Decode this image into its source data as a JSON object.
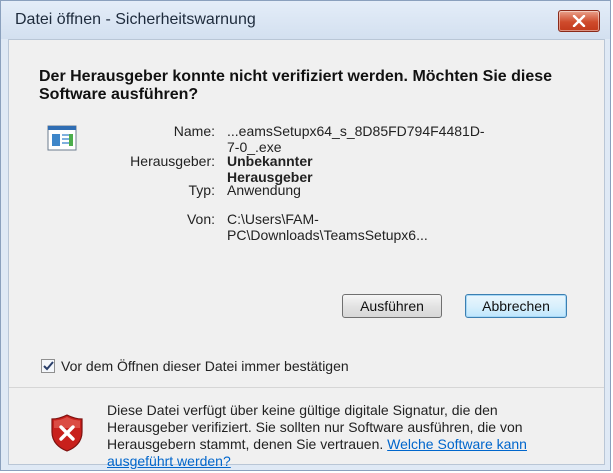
{
  "window": {
    "title": "Datei öffnen - Sicherheitswarnung"
  },
  "heading": "Der Herausgeber konnte nicht verifiziert werden. Möchten Sie diese Software ausführen?",
  "details": {
    "name_label": "Name:",
    "name_value": "...eamsSetupx64_s_8D85FD794F4481D-7-0_.exe",
    "publisher_label": "Herausgeber:",
    "publisher_value": "Unbekannter Herausgeber",
    "type_label": "Typ:",
    "type_value": "Anwendung",
    "from_label": "Von:",
    "from_value": "C:\\Users\\FAM-PC\\Downloads\\TeamsSetupx6..."
  },
  "buttons": {
    "run": "Ausführen",
    "cancel": "Abbrechen"
  },
  "checkbox": {
    "label": "Vor dem Öffnen dieser Datei immer bestätigen",
    "checked": true
  },
  "warning": {
    "text": "Diese Datei verfügt über keine gültige digitale Signatur, die den Herausgeber verifiziert. Sie sollten nur Software ausführen, die von Herausgebern stammt, denen Sie vertrauen. ",
    "link": "Welche Software kann ausgeführt werden?"
  },
  "colors": {
    "close_button": "#cf4b2c",
    "link": "#0066cc",
    "shield_red": "#c8201c"
  },
  "icons": {
    "close": "close-icon",
    "app": "application-icon",
    "shield": "shield-warning-icon",
    "check": "checkmark-icon"
  }
}
